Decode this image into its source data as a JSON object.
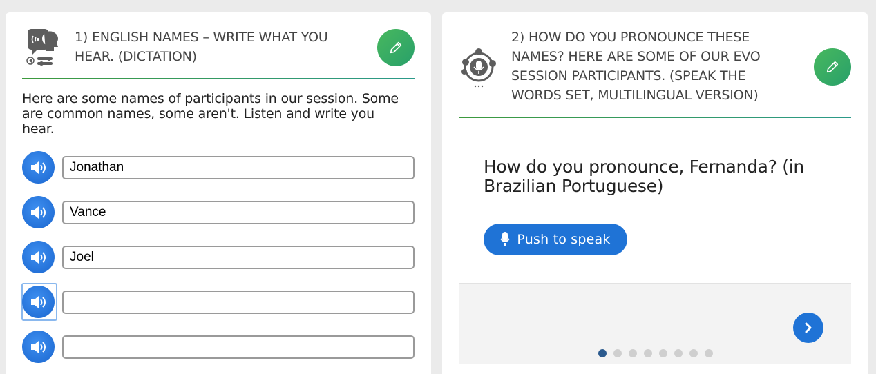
{
  "left_card": {
    "title": "1) ENGLISH NAMES – WRITE WHAT YOU HEAR. (DICTATION)",
    "icon": "dictation-icon",
    "description": "Here are some names of participants in our session. Some are common names, some aren't. Listen and write you hear.",
    "rows": [
      {
        "value": "Jonathan"
      },
      {
        "value": "Vance"
      },
      {
        "value": "Joel"
      },
      {
        "value": ""
      },
      {
        "value": ""
      }
    ]
  },
  "right_card": {
    "title": "2) HOW DO YOU PRONOUNCE THESE NAMES? HERE ARE SOME OF OUR EVO SESSION PARTICIPANTS. (SPEAK THE WORDS SET, MULTILINGUAL VERSION)",
    "icon": "speak-words-icon",
    "question": "How do you pronounce, Fernanda? (in Brazilian Portuguese)",
    "speak_label": "Push to speak",
    "slide_count": 8,
    "active_slide": 1
  },
  "colors": {
    "accent_blue": "#1f73d6",
    "edit_green": "#3aab60",
    "active_dot": "#2b5a8e"
  }
}
